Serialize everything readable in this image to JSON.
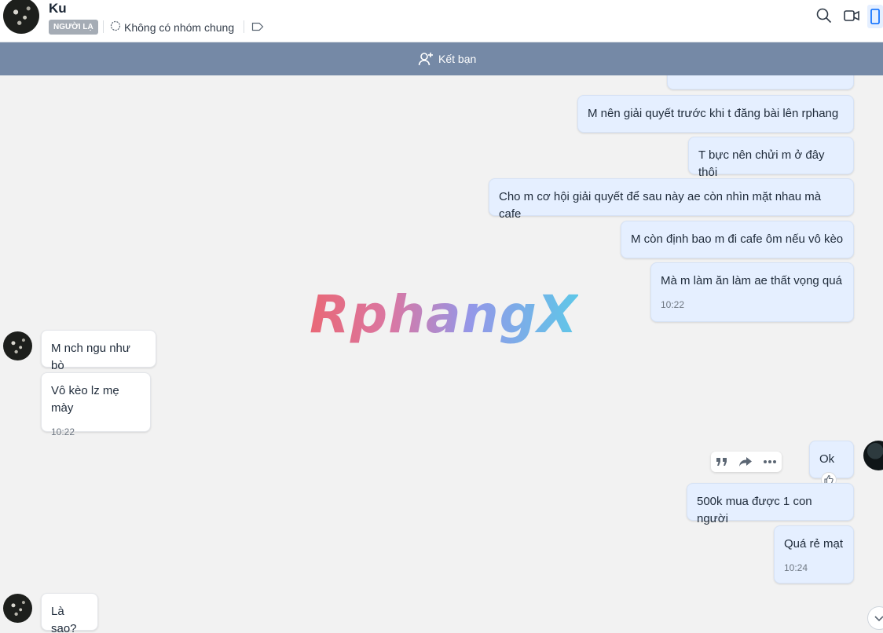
{
  "header": {
    "contact_name": "Ku",
    "badge": "NGƯỜI LẠ",
    "group_info": "Không có nhóm chung"
  },
  "friend_bar": {
    "label": "Kết bạn"
  },
  "watermark": "RphangX",
  "messages": [
    {
      "dir": "out",
      "text": "M nên giải quyết trước khi t đăng bài lên rphang"
    },
    {
      "dir": "out",
      "text": "T bực nên chửi m ở đây thôi"
    },
    {
      "dir": "out",
      "text": "Cho m cơ hội giải quyết để sau này ae còn nhìn mặt nhau mà cafe"
    },
    {
      "dir": "out",
      "text": "M còn định bao m đi cafe ôm nếu vô kèo"
    },
    {
      "dir": "out",
      "text": "Mà m làm ăn làm ae thất vọng quá",
      "time": "10:22"
    },
    {
      "dir": "in",
      "text": "M nch ngu như bò"
    },
    {
      "dir": "in",
      "text": "Vô kèo lz mẹ mày",
      "time": "10:22"
    },
    {
      "dir": "out",
      "text": "Ok"
    },
    {
      "dir": "out",
      "text": "500k mua được 1 con người"
    },
    {
      "dir": "out",
      "text": "Quá rẻ mạt",
      "time": "10:24"
    },
    {
      "dir": "in",
      "text": "Là sao?"
    }
  ],
  "icons": {
    "header_actions": [
      "search-icon",
      "video-call-icon",
      "panel-toggle-icon"
    ],
    "message_actions": [
      "quote-icon",
      "forward-icon",
      "more-icon"
    ]
  },
  "colors": {
    "friend_bar": "#7589a6",
    "outgoing_bubble": "#e5efff",
    "incoming_bubble": "#ffffff",
    "chat_background": "#f2f2f2"
  }
}
